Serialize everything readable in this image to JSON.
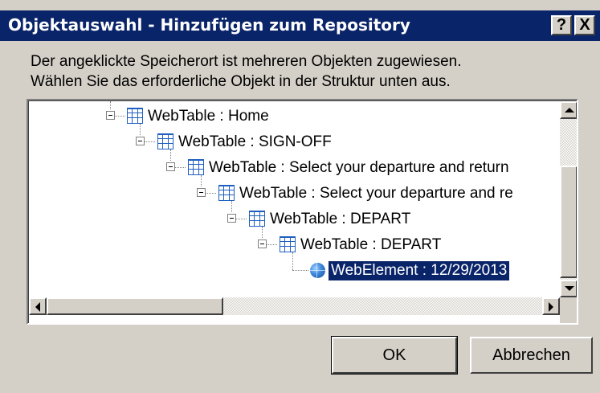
{
  "dialog": {
    "title": "Objektauswahl - Hinzufügen zum Repository",
    "help_label": "?",
    "close_label": "X"
  },
  "instructions": {
    "line1": "Der angeklickte Speicherort ist mehreren Objekten zugewiesen.",
    "line2": "Wählen Sie das erforderliche Objekt in der Struktur unten aus."
  },
  "tree": {
    "nodes": [
      {
        "label": "WebTable : Home",
        "icon": "table-icon",
        "expanded": true
      },
      {
        "label": "WebTable : SIGN-OFF",
        "icon": "table-icon",
        "expanded": true
      },
      {
        "label": "WebTable : Select your departure and return",
        "icon": "table-icon",
        "expanded": true
      },
      {
        "label": "WebTable : Select your departure and re",
        "icon": "table-icon",
        "expanded": true
      },
      {
        "label": "WebTable : DEPART",
        "icon": "table-icon",
        "expanded": true
      },
      {
        "label": "WebTable : DEPART",
        "icon": "table-icon",
        "expanded": true
      },
      {
        "label": "WebElement : 12/29/2013",
        "icon": "globe-icon",
        "selected": true
      }
    ]
  },
  "buttons": {
    "ok": "OK",
    "cancel": "Abbrechen"
  },
  "colors": {
    "titlebar": "#0a246a",
    "selection": "#0a246a",
    "face": "#d4d0c8"
  }
}
